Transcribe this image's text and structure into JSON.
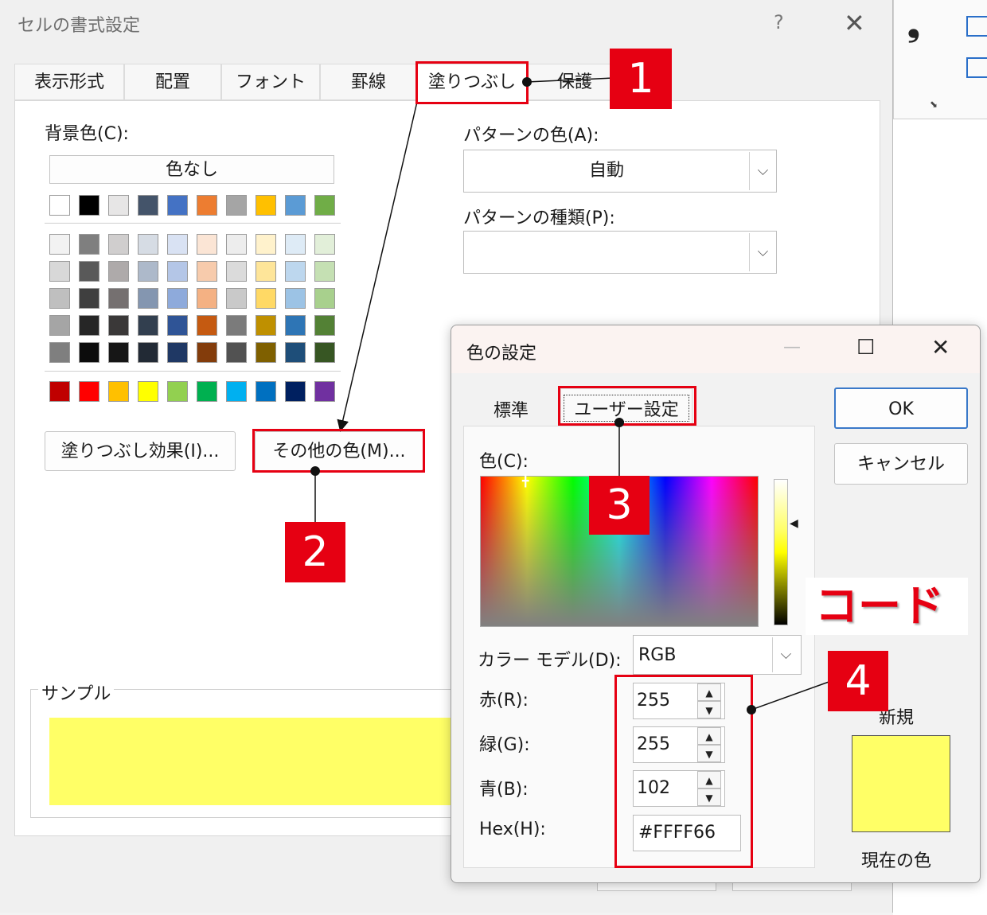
{
  "dialog": {
    "title": "セルの書式設定",
    "help": "?",
    "close": "✕",
    "tabs": [
      "表示形式",
      "配置",
      "フォント",
      "罫線",
      "塗りつぶし",
      "保護"
    ],
    "background_color_label": "背景色(C):",
    "no_color_label": "色なし",
    "pattern_color_label": "パターンの色(A):",
    "pattern_color_value": "自動",
    "pattern_type_label": "パターンの種類(P):",
    "fill_effects_button": "塗りつぶし効果(I)...",
    "more_colors_button": "その他の色(M)...",
    "sample_label": "サンプル",
    "sample_color": "#FFFF66"
  },
  "palette": {
    "theme_top": [
      "#FFFFFF",
      "#000000",
      "#E7E6E6",
      "#44546A",
      "#4472C4",
      "#ED7D31",
      "#A5A5A5",
      "#FFC000",
      "#5B9BD5",
      "#70AD47"
    ],
    "theme_rows": [
      [
        "#F2F2F2",
        "#7F7F7F",
        "#D0CECE",
        "#D6DCE4",
        "#D9E2F3",
        "#FBE5D5",
        "#EDEDED",
        "#FFF2CC",
        "#DEEBF6",
        "#E2EFD9"
      ],
      [
        "#D8D8D8",
        "#595959",
        "#AEAAAA",
        "#ADB9CA",
        "#B4C6E7",
        "#F7CBAC",
        "#DBDBDB",
        "#FEE599",
        "#BDD7EE",
        "#C5E0B3"
      ],
      [
        "#BFBFBF",
        "#3F3F3F",
        "#757070",
        "#8496B0",
        "#8EAADB",
        "#F4B183",
        "#C9C9C9",
        "#FFD965",
        "#9CC3E5",
        "#A8D08D"
      ],
      [
        "#A5A5A5",
        "#262626",
        "#3A3838",
        "#323F4F",
        "#2F5496",
        "#C55A11",
        "#7B7B7B",
        "#BF9000",
        "#2E75B5",
        "#538135"
      ],
      [
        "#7F7F7F",
        "#0C0C0C",
        "#161616",
        "#222A35",
        "#1F3864",
        "#833C0B",
        "#525252",
        "#7F6000",
        "#1E4E79",
        "#375623"
      ]
    ],
    "standard": [
      "#C00000",
      "#FF0000",
      "#FFC000",
      "#FFFF00",
      "#92D050",
      "#00B050",
      "#00B0F0",
      "#0070C0",
      "#002060",
      "#7030A0"
    ]
  },
  "color_dialog": {
    "title": "色の設定",
    "minimize": "—",
    "maximize": "☐",
    "close": "✕",
    "tab_standard": "標準",
    "tab_custom": "ユーザー設定",
    "ok": "OK",
    "cancel": "キャンセル",
    "color_label": "色(C):",
    "model_label": "カラー モデル(D):",
    "model_value": "RGB",
    "red_label": "赤(R):",
    "red_value": "255",
    "green_label": "緑(G):",
    "green_value": "255",
    "blue_label": "青(B):",
    "blue_value": "102",
    "hex_label": "Hex(H):",
    "hex_value": "#FFFF66",
    "new_label": "新規",
    "current_label": "現在の色",
    "new_color": "#FFFF66",
    "current_color": "#FFFF66"
  },
  "annotations": {
    "tags": [
      "1",
      "2",
      "3",
      "4"
    ],
    "code_label": "コード"
  },
  "ribbon": {
    "comma": "❟"
  }
}
